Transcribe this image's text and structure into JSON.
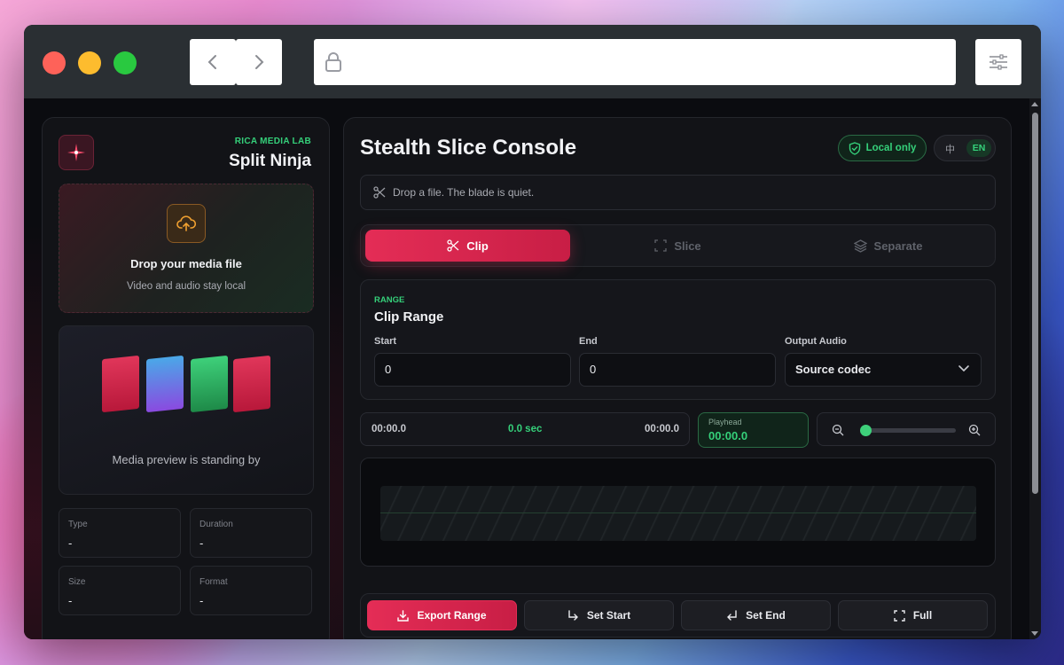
{
  "app": {
    "brand_kicker": "RICA MEDIA LAB",
    "brand_name": "Split Ninja",
    "title": "Split Ninja"
  },
  "dropzone": {
    "title": "Drop your media file",
    "subtitle": "Video and audio stay local"
  },
  "preview": {
    "status": "Media preview is standing by"
  },
  "meta": {
    "type_label": "Type",
    "type_value": "-",
    "duration_label": "Duration",
    "duration_value": "-",
    "size_label": "Size",
    "size_value": "-",
    "format_label": "Format",
    "format_value": "-"
  },
  "header": {
    "console_title": "Stealth Slice Console",
    "local_badge": "Local only",
    "lang_zh": "中",
    "lang_en": "EN"
  },
  "status": {
    "message": "Drop a file. The blade is quiet."
  },
  "tabs": [
    {
      "label": "Clip",
      "active": true
    },
    {
      "label": "Slice",
      "active": false
    },
    {
      "label": "Separate",
      "active": false
    }
  ],
  "range": {
    "kicker": "RANGE",
    "title": "Clip Range",
    "start_label": "Start",
    "start_value": "0",
    "end_label": "End",
    "end_value": "0",
    "audio_label": "Output Audio",
    "audio_value": "Source codec"
  },
  "timeline": {
    "start_time": "00:00.0",
    "duration": "0.0 sec",
    "end_time": "00:00.0",
    "playhead_label": "Playhead",
    "playhead_value": "00:00.0",
    "zoom_level": 0
  },
  "actions": {
    "export": "Export Range",
    "set_start": "Set Start",
    "set_end": "Set End",
    "full": "Full"
  },
  "colors": {
    "accent": "#e42d56",
    "success": "#35d07a"
  }
}
